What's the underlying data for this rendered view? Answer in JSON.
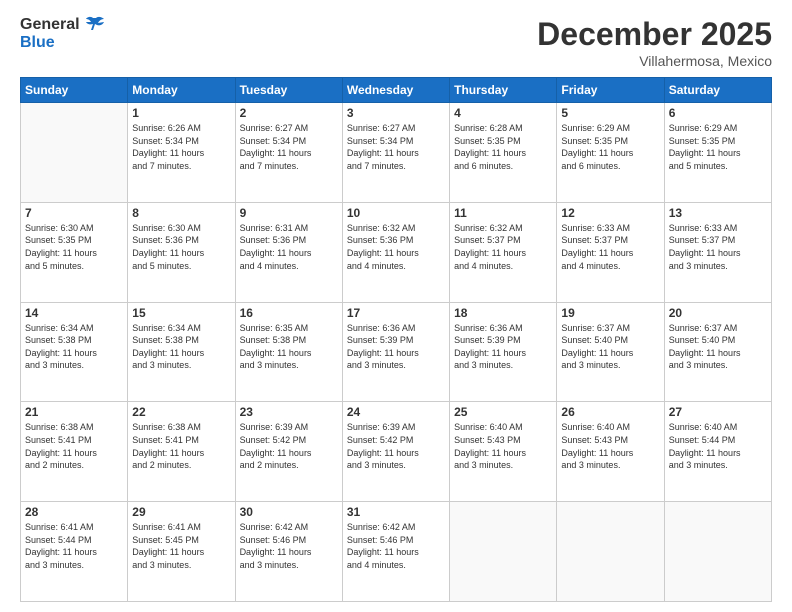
{
  "header": {
    "logo_general": "General",
    "logo_blue": "Blue",
    "month_title": "December 2025",
    "location": "Villahermosa, Mexico"
  },
  "weekdays": [
    "Sunday",
    "Monday",
    "Tuesday",
    "Wednesday",
    "Thursday",
    "Friday",
    "Saturday"
  ],
  "weeks": [
    [
      {
        "day": "",
        "info": ""
      },
      {
        "day": "1",
        "info": "Sunrise: 6:26 AM\nSunset: 5:34 PM\nDaylight: 11 hours\nand 7 minutes."
      },
      {
        "day": "2",
        "info": "Sunrise: 6:27 AM\nSunset: 5:34 PM\nDaylight: 11 hours\nand 7 minutes."
      },
      {
        "day": "3",
        "info": "Sunrise: 6:27 AM\nSunset: 5:34 PM\nDaylight: 11 hours\nand 7 minutes."
      },
      {
        "day": "4",
        "info": "Sunrise: 6:28 AM\nSunset: 5:35 PM\nDaylight: 11 hours\nand 6 minutes."
      },
      {
        "day": "5",
        "info": "Sunrise: 6:29 AM\nSunset: 5:35 PM\nDaylight: 11 hours\nand 6 minutes."
      },
      {
        "day": "6",
        "info": "Sunrise: 6:29 AM\nSunset: 5:35 PM\nDaylight: 11 hours\nand 5 minutes."
      }
    ],
    [
      {
        "day": "7",
        "info": "Sunrise: 6:30 AM\nSunset: 5:35 PM\nDaylight: 11 hours\nand 5 minutes."
      },
      {
        "day": "8",
        "info": "Sunrise: 6:30 AM\nSunset: 5:36 PM\nDaylight: 11 hours\nand 5 minutes."
      },
      {
        "day": "9",
        "info": "Sunrise: 6:31 AM\nSunset: 5:36 PM\nDaylight: 11 hours\nand 4 minutes."
      },
      {
        "day": "10",
        "info": "Sunrise: 6:32 AM\nSunset: 5:36 PM\nDaylight: 11 hours\nand 4 minutes."
      },
      {
        "day": "11",
        "info": "Sunrise: 6:32 AM\nSunset: 5:37 PM\nDaylight: 11 hours\nand 4 minutes."
      },
      {
        "day": "12",
        "info": "Sunrise: 6:33 AM\nSunset: 5:37 PM\nDaylight: 11 hours\nand 4 minutes."
      },
      {
        "day": "13",
        "info": "Sunrise: 6:33 AM\nSunset: 5:37 PM\nDaylight: 11 hours\nand 3 minutes."
      }
    ],
    [
      {
        "day": "14",
        "info": "Sunrise: 6:34 AM\nSunset: 5:38 PM\nDaylight: 11 hours\nand 3 minutes."
      },
      {
        "day": "15",
        "info": "Sunrise: 6:34 AM\nSunset: 5:38 PM\nDaylight: 11 hours\nand 3 minutes."
      },
      {
        "day": "16",
        "info": "Sunrise: 6:35 AM\nSunset: 5:38 PM\nDaylight: 11 hours\nand 3 minutes."
      },
      {
        "day": "17",
        "info": "Sunrise: 6:36 AM\nSunset: 5:39 PM\nDaylight: 11 hours\nand 3 minutes."
      },
      {
        "day": "18",
        "info": "Sunrise: 6:36 AM\nSunset: 5:39 PM\nDaylight: 11 hours\nand 3 minutes."
      },
      {
        "day": "19",
        "info": "Sunrise: 6:37 AM\nSunset: 5:40 PM\nDaylight: 11 hours\nand 3 minutes."
      },
      {
        "day": "20",
        "info": "Sunrise: 6:37 AM\nSunset: 5:40 PM\nDaylight: 11 hours\nand 3 minutes."
      }
    ],
    [
      {
        "day": "21",
        "info": "Sunrise: 6:38 AM\nSunset: 5:41 PM\nDaylight: 11 hours\nand 2 minutes."
      },
      {
        "day": "22",
        "info": "Sunrise: 6:38 AM\nSunset: 5:41 PM\nDaylight: 11 hours\nand 2 minutes."
      },
      {
        "day": "23",
        "info": "Sunrise: 6:39 AM\nSunset: 5:42 PM\nDaylight: 11 hours\nand 2 minutes."
      },
      {
        "day": "24",
        "info": "Sunrise: 6:39 AM\nSunset: 5:42 PM\nDaylight: 11 hours\nand 3 minutes."
      },
      {
        "day": "25",
        "info": "Sunrise: 6:40 AM\nSunset: 5:43 PM\nDaylight: 11 hours\nand 3 minutes."
      },
      {
        "day": "26",
        "info": "Sunrise: 6:40 AM\nSunset: 5:43 PM\nDaylight: 11 hours\nand 3 minutes."
      },
      {
        "day": "27",
        "info": "Sunrise: 6:40 AM\nSunset: 5:44 PM\nDaylight: 11 hours\nand 3 minutes."
      }
    ],
    [
      {
        "day": "28",
        "info": "Sunrise: 6:41 AM\nSunset: 5:44 PM\nDaylight: 11 hours\nand 3 minutes."
      },
      {
        "day": "29",
        "info": "Sunrise: 6:41 AM\nSunset: 5:45 PM\nDaylight: 11 hours\nand 3 minutes."
      },
      {
        "day": "30",
        "info": "Sunrise: 6:42 AM\nSunset: 5:46 PM\nDaylight: 11 hours\nand 3 minutes."
      },
      {
        "day": "31",
        "info": "Sunrise: 6:42 AM\nSunset: 5:46 PM\nDaylight: 11 hours\nand 4 minutes."
      },
      {
        "day": "",
        "info": ""
      },
      {
        "day": "",
        "info": ""
      },
      {
        "day": "",
        "info": ""
      }
    ]
  ]
}
